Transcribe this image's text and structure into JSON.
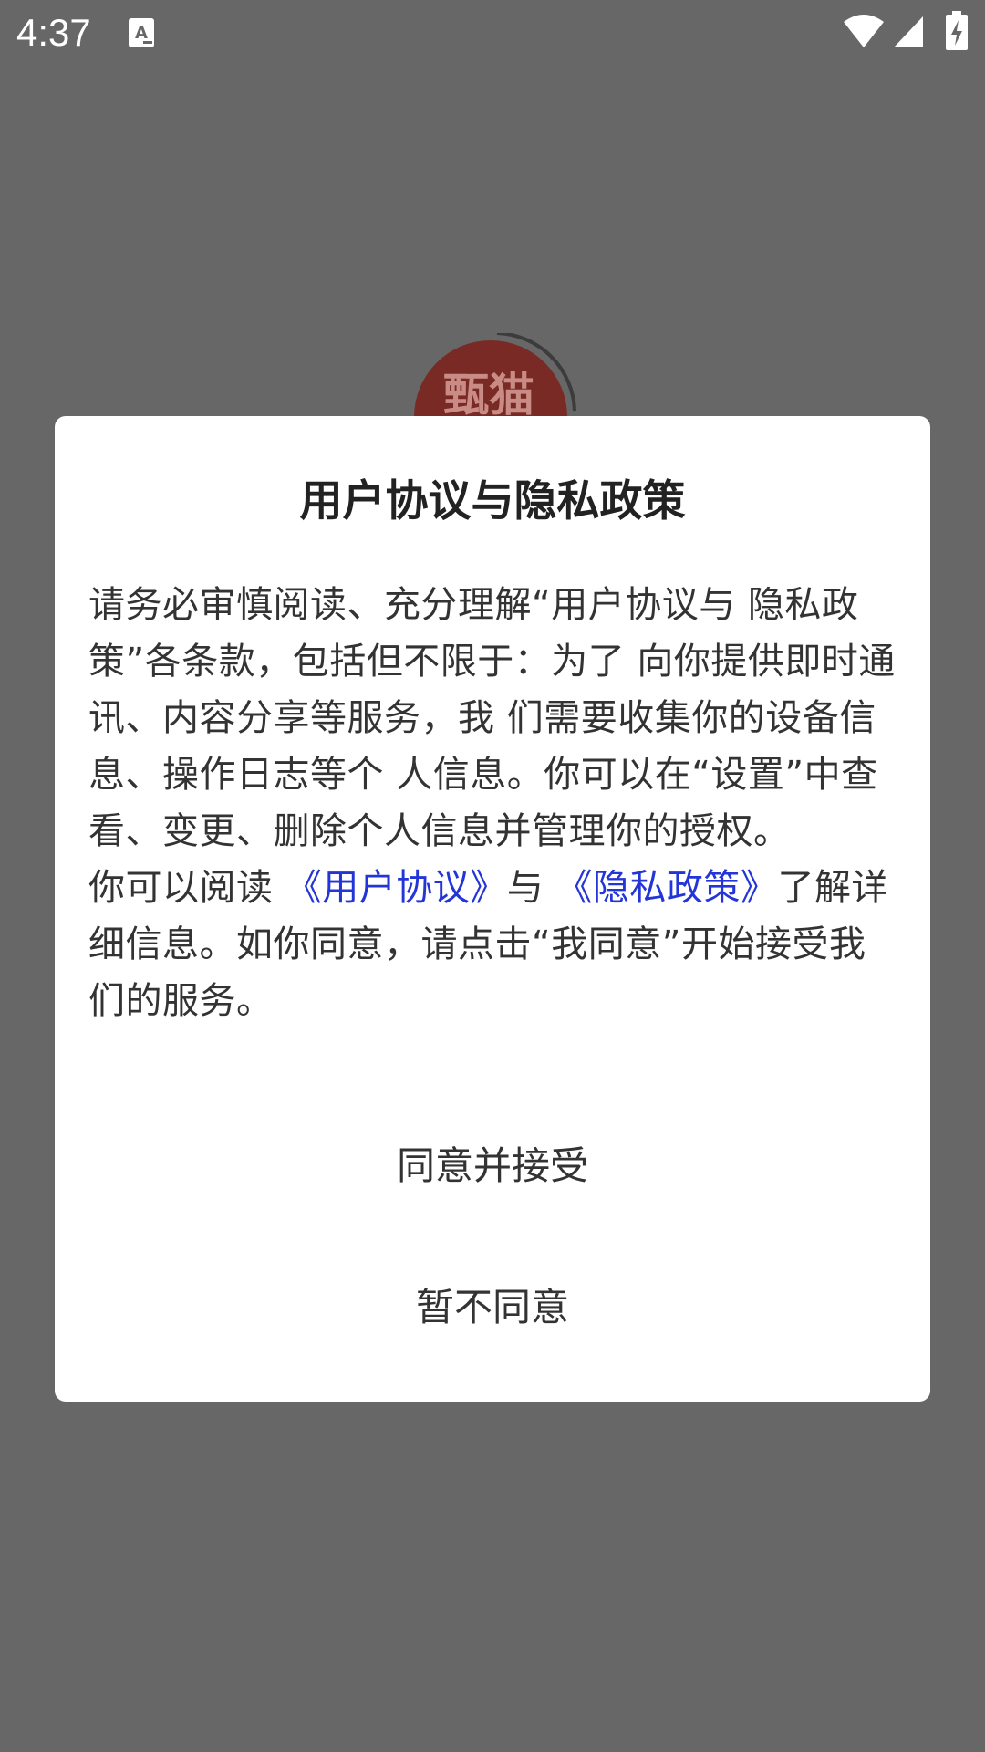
{
  "status_bar": {
    "time": "4:37",
    "icons": [
      "notification-a-icon",
      "wifi-icon",
      "signal-icon",
      "battery-charging-icon"
    ]
  },
  "splash": {
    "logo_text": "甄猫",
    "logo_color": "#b31b10"
  },
  "dialog": {
    "title": "用户协议与隐私政策",
    "paragraph1": " 请务必审慎阅读、充分理解“用户协议与 隐私政策”各条款，包括但不限于：为了 向你提供即时通讯、内容分享等服务，我 们需要收集你的设备信息、操作日志等个 人信息。你可以在“设置”中查看、变更、删除个人信息并管理你的授权。",
    "p2_prefix": "你可以阅读 ",
    "link_user_agreement": "《用户协议》",
    "p2_and": "与 ",
    "link_privacy_policy": "《隐私政策》",
    "p2_suffix": "了解详细信息。如你同意，请点击“我同意”开始接受我们的服务。",
    "link_color": "#2435d8",
    "agree_button": "同意并接受",
    "decline_button": "暂不同意"
  }
}
